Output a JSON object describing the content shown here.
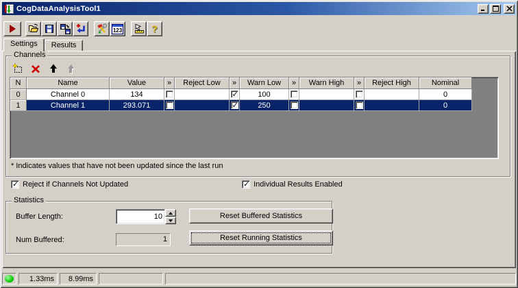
{
  "window": {
    "title": "CogDataAnalysisTool1"
  },
  "toolbar": {
    "numeric_label": "123",
    "help_label": "?"
  },
  "tabs": {
    "settings": "Settings",
    "results": "Results"
  },
  "channels": {
    "title": "Channels",
    "note": "* Indicates values that have not been updated since the last run",
    "table": {
      "columns": [
        "N",
        "Name",
        "Value",
        "»",
        "Reject Low",
        "»",
        "Warn Low",
        "»",
        "Warn High",
        "»",
        "Reject High",
        "Nominal"
      ],
      "rows": [
        {
          "n": "0",
          "name": "Channel 0",
          "value": "134",
          "reject_low": "",
          "warn_low": "100",
          "warn_high": "",
          "reject_high": "",
          "nominal": "0",
          "selected": false,
          "checks": {
            "reject_low": false,
            "warn_low": true,
            "warn_high": false,
            "reject_high": false
          }
        },
        {
          "n": "1",
          "name": "Channel 1",
          "value": "293.071",
          "reject_low": "",
          "warn_low": "250",
          "warn_high": "",
          "reject_high": "",
          "nominal": "0",
          "selected": true,
          "checks": {
            "reject_low": false,
            "warn_low": true,
            "warn_high": false,
            "reject_high": false
          }
        }
      ]
    }
  },
  "options": {
    "reject_label": "Reject if Channels Not Updated",
    "reject_checked": true,
    "individual_label": "Individual Results Enabled",
    "individual_checked": true
  },
  "statistics": {
    "title": "Statistics",
    "buffer_length_label": "Buffer Length:",
    "buffer_length_value": "10",
    "num_buffered_label": "Num Buffered:",
    "num_buffered_value": "1",
    "reset_buffered_label": "Reset Buffered Statistics",
    "reset_running_label": "Reset Running Statistics"
  },
  "statusbar": {
    "status_color": "#00C800",
    "time_1": "1.33ms",
    "time_2": "8.99ms"
  }
}
